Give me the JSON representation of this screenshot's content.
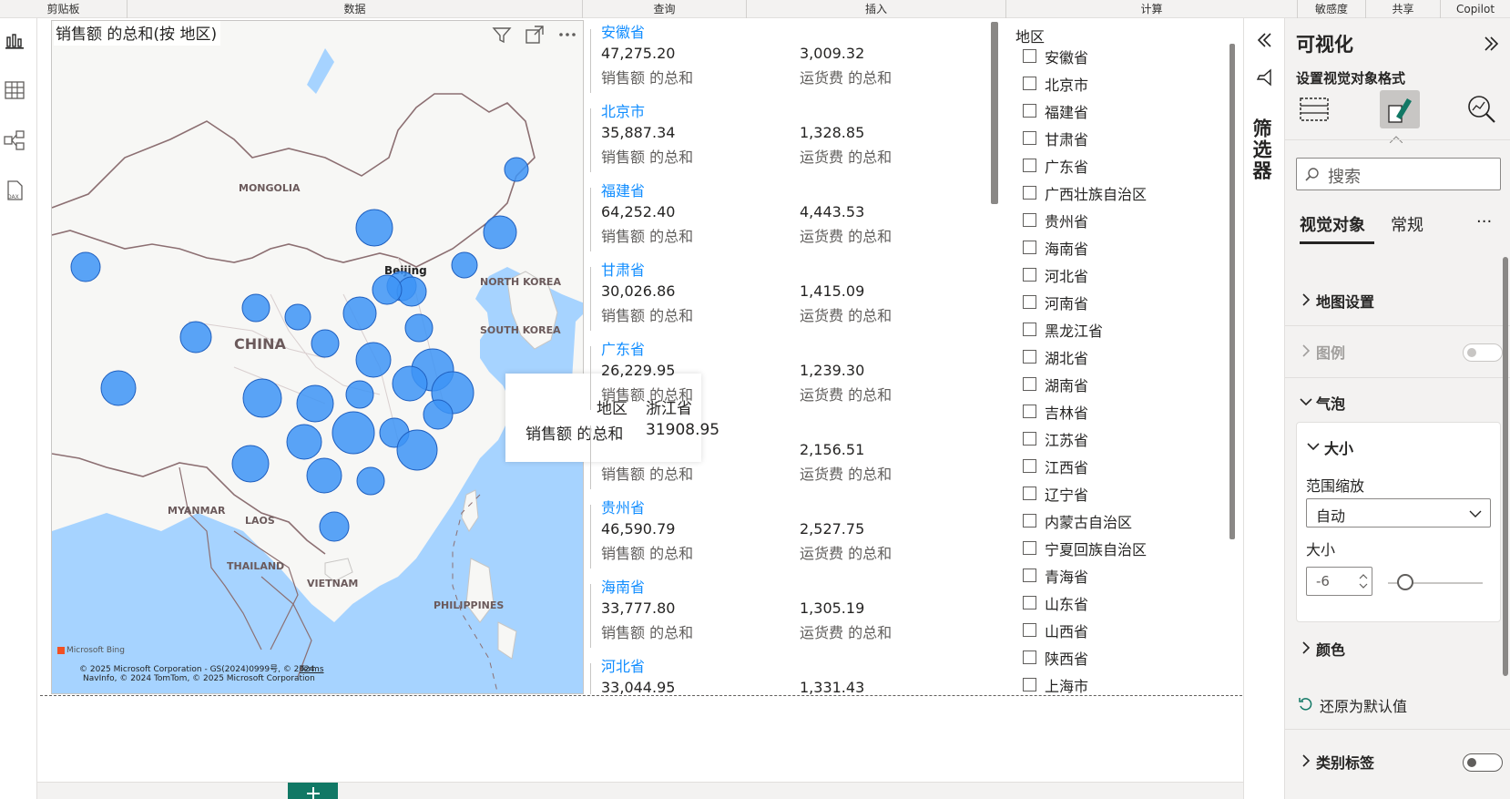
{
  "ribbon": {
    "groups": [
      "剪贴板",
      "数据",
      "查询",
      "插入",
      "计算",
      "敏感度",
      "共享",
      "Copilot"
    ]
  },
  "map": {
    "title": "销售额 的总和(按 地区)",
    "labels": {
      "mongolia": "MONGOLIA",
      "china": "CHINA",
      "beijing": "Beijing",
      "north_korea": "NORTH KOREA",
      "south_korea": "SOUTH KOREA",
      "myanmar": "MYANMAR",
      "laos": "LAOS",
      "thailand": "THAILAND",
      "vietnam": "VIETNAM",
      "philippines": "PHILIPPINES"
    },
    "bing": "Microsoft Bing",
    "copyright_line1": "© 2025 Microsoft Corporation - GS(2024)0999号, © 2024",
    "copyright_line2": "NavInfo, © 2024 TomTom, © 2025 Microsoft Corporation",
    "terms": "Terms",
    "tooltip": {
      "row1_label": "地区",
      "row1_value": "浙江省",
      "row2_label": "销售额 的总和",
      "row2_value": "31908.95"
    }
  },
  "cards": [
    {
      "name": "安徽省",
      "sales": "47,275.20",
      "sales_label": "销售额 的总和",
      "freight": "3,009.32",
      "freight_label": "运货费 的总和"
    },
    {
      "name": "北京市",
      "sales": "35,887.34",
      "sales_label": "销售额 的总和",
      "freight": "1,328.85",
      "freight_label": "运货费 的总和"
    },
    {
      "name": "福建省",
      "sales": "64,252.40",
      "sales_label": "销售额 的总和",
      "freight": "4,443.53",
      "freight_label": "运货费 的总和"
    },
    {
      "name": "甘肃省",
      "sales": "30,026.86",
      "sales_label": "销售额 的总和",
      "freight": "1,415.09",
      "freight_label": "运货费 的总和"
    },
    {
      "name": "广东省",
      "sales": "26,229.95",
      "sales_label": "销售额 的总和",
      "freight": "1,239.30",
      "freight_label": "运货费 的总和"
    },
    {
      "name": "",
      "sales": "",
      "sales_label": "销售额 的总和",
      "freight": "2,156.51",
      "freight_label": "运货费 的总和"
    },
    {
      "name": "贵州省",
      "sales": "46,590.79",
      "sales_label": "销售额 的总和",
      "freight": "2,527.75",
      "freight_label": "运货费 的总和"
    },
    {
      "name": "海南省",
      "sales": "33,777.80",
      "sales_label": "销售额 的总和",
      "freight": "1,305.19",
      "freight_label": "运货费 的总和"
    },
    {
      "name": "河北省",
      "sales": "33,044.95",
      "sales_label": "",
      "freight": "1,331.43",
      "freight_label": ""
    }
  ],
  "slicer": {
    "title": "地区",
    "items": [
      "安徽省",
      "北京市",
      "福建省",
      "甘肃省",
      "广东省",
      "广西壮族自治区",
      "贵州省",
      "海南省",
      "河北省",
      "河南省",
      "黑龙江省",
      "湖北省",
      "湖南省",
      "吉林省",
      "江苏省",
      "江西省",
      "辽宁省",
      "内蒙古自治区",
      "宁夏回族自治区",
      "青海省",
      "山东省",
      "山西省",
      "陕西省",
      "上海市"
    ]
  },
  "filters": {
    "label": "筛选器"
  },
  "viz": {
    "title": "可视化",
    "subtitle": "设置视觉对象格式",
    "search_placeholder": "搜索",
    "tab_visual": "视觉对象",
    "tab_general": "常规",
    "more": "···",
    "sections": {
      "map_settings": "地图设置",
      "legend": "图例",
      "bubbles": "气泡",
      "size": "大小",
      "range_scale": "范围缩放",
      "range_value": "自动",
      "size_label": "大小",
      "size_value": "-6",
      "color": "颜色",
      "reset": "还原为默认值",
      "category_labels": "类别标签"
    }
  },
  "colors": {
    "accent": "#118dff",
    "bubble": "#3d94f6",
    "water": "#a6d3ff",
    "land": "#f7f7f5",
    "border": "#8c6f72"
  }
}
